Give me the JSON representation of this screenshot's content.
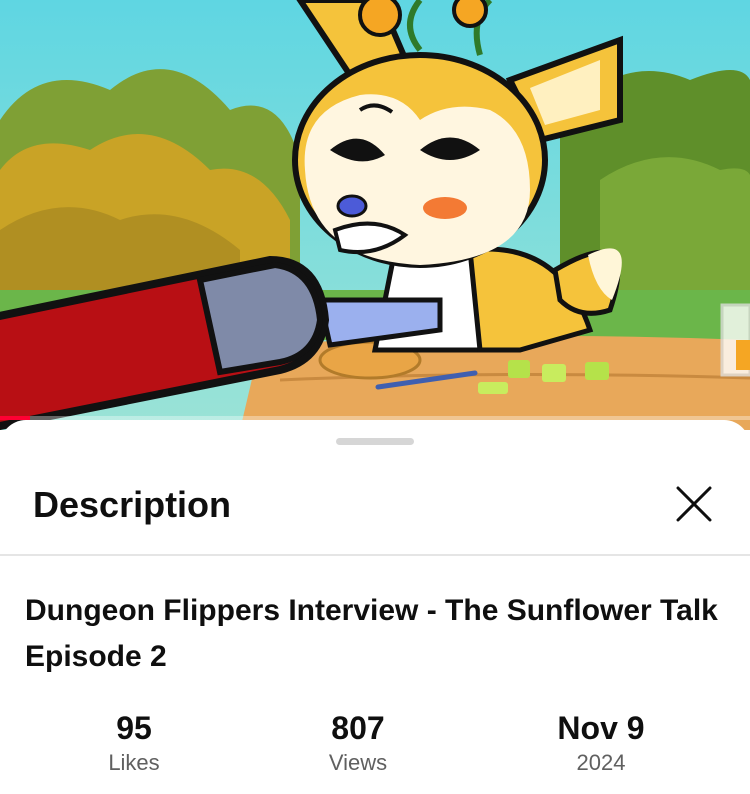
{
  "video": {
    "progress_fraction": 0.04,
    "colors": {
      "sky": "#6fd8e0",
      "foliage": "#5f8f2a",
      "character_fur": "#f5c33b",
      "progress": "#ff0033"
    }
  },
  "description_panel": {
    "title": "Description",
    "close_icon": "close-icon",
    "video_title": "Dungeon Flippers Interview - The Sunflower Talk Episode 2",
    "stats": [
      {
        "value": "95",
        "label": "Likes"
      },
      {
        "value": "807",
        "label": "Views"
      },
      {
        "value": "Nov 9",
        "label": "2024"
      }
    ]
  }
}
